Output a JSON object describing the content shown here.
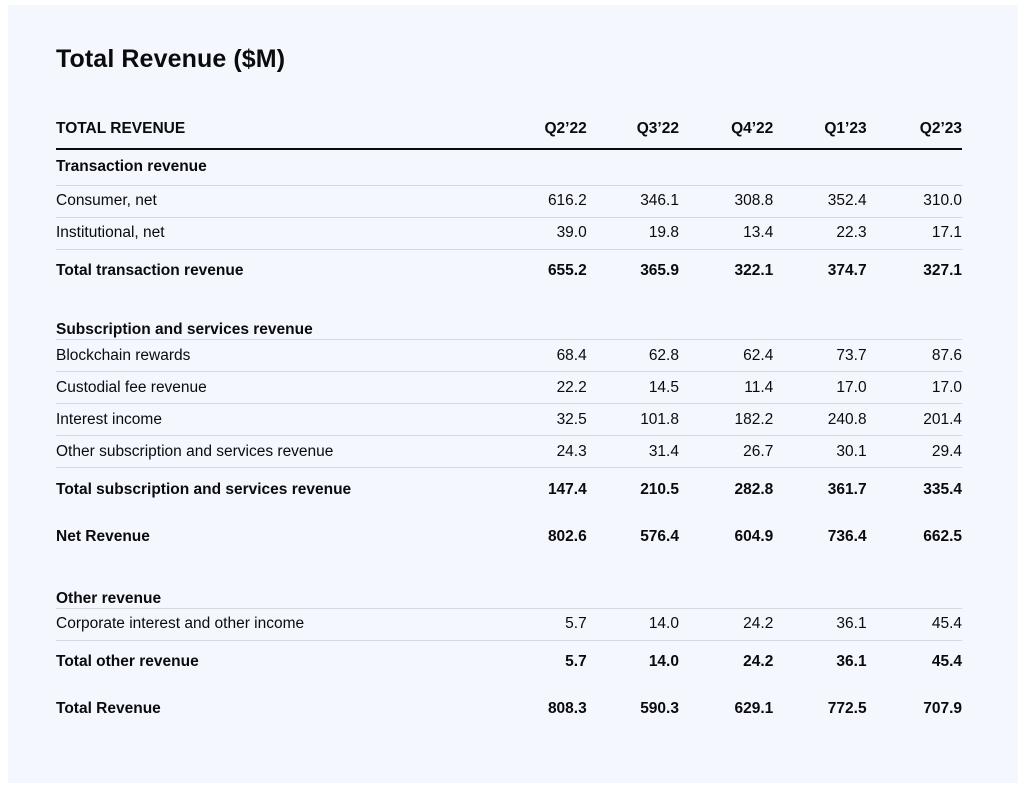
{
  "chart_data": {
    "type": "table",
    "title": "Total Revenue ($M)",
    "header_label": "TOTAL REVENUE",
    "columns": [
      "Q2’22",
      "Q3’22",
      "Q4’22",
      "Q1’23",
      "Q2’23"
    ],
    "sections": [
      {
        "heading": "Transaction revenue",
        "rows": [
          {
            "label": "Consumer, net",
            "values": [
              "616.2",
              "346.1",
              "308.8",
              "352.4",
              "310.0"
            ]
          },
          {
            "label": "Institutional, net",
            "values": [
              "39.0",
              "19.8",
              "13.4",
              "22.3",
              "17.1"
            ]
          }
        ],
        "total": {
          "label": "Total transaction revenue",
          "values": [
            "655.2",
            "365.9",
            "322.1",
            "374.7",
            "327.1"
          ]
        }
      },
      {
        "heading": "Subscription and services revenue",
        "rows": [
          {
            "label": "Blockchain rewards",
            "values": [
              "68.4",
              "62.8",
              "62.4",
              "73.7",
              "87.6"
            ]
          },
          {
            "label": "Custodial fee revenue",
            "values": [
              "22.2",
              "14.5",
              "11.4",
              "17.0",
              "17.0"
            ]
          },
          {
            "label": "Interest income",
            "values": [
              "32.5",
              "101.8",
              "182.2",
              "240.8",
              "201.4"
            ]
          },
          {
            "label": "Other subscription and services revenue",
            "values": [
              "24.3",
              "31.4",
              "26.7",
              "30.1",
              "29.4"
            ]
          }
        ],
        "total": {
          "label": "Total subscription and services revenue",
          "values": [
            "147.4",
            "210.5",
            "282.8",
            "361.7",
            "335.4"
          ]
        }
      }
    ],
    "net_revenue": {
      "label": "Net Revenue",
      "values": [
        "802.6",
        "576.4",
        "604.9",
        "736.4",
        "662.5"
      ]
    },
    "other": {
      "heading": "Other revenue",
      "rows": [
        {
          "label": "Corporate interest and other income",
          "values": [
            "5.7",
            "14.0",
            "24.2",
            "36.1",
            "45.4"
          ]
        }
      ],
      "total": {
        "label": "Total other revenue",
        "values": [
          "5.7",
          "14.0",
          "24.2",
          "36.1",
          "45.4"
        ]
      }
    },
    "total_revenue": {
      "label": "Total Revenue",
      "values": [
        "808.3",
        "590.3",
        "629.1",
        "772.5",
        "707.9"
      ]
    }
  }
}
